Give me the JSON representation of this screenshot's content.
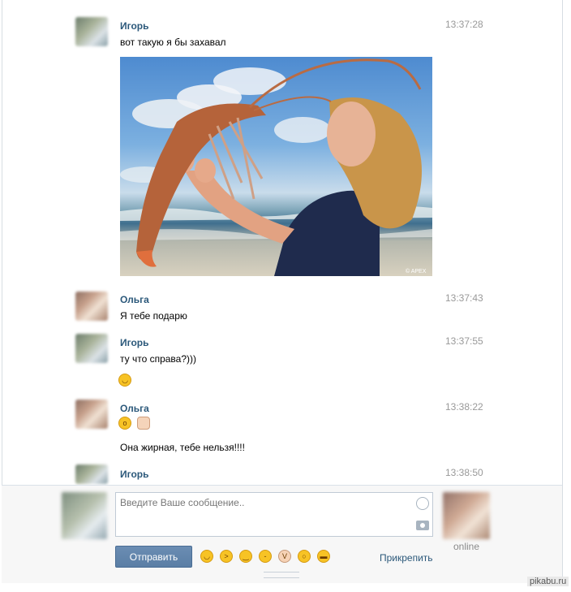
{
  "messages": [
    {
      "author": "Игорь",
      "time": "13:37:28",
      "text": "вот такую я бы захавал"
    },
    {
      "author": "Ольга",
      "time": "13:37:43",
      "text": "Я тебе подарю"
    },
    {
      "author": "Игорь",
      "time": "13:37:55",
      "text": "ту что справа?)))"
    },
    {
      "author": "Ольга",
      "time": "13:38:22",
      "text": "Она жирная, тебе нельзя!!!!"
    },
    {
      "author": "Игорь",
      "time": "13:38:50",
      "text": ""
    }
  ],
  "photo": {
    "credit": "© APEX"
  },
  "composer": {
    "placeholder": "Введите Ваше сообщение..",
    "send_label": "Отправить",
    "attach_label": "Прикрепить",
    "peer_status": "online",
    "emoji_bar": [
      "laughing",
      "grinning-squint",
      "blush",
      "yum",
      "victory-hand",
      "scared",
      "sunglasses"
    ]
  },
  "watermark": "pikabu.ru"
}
